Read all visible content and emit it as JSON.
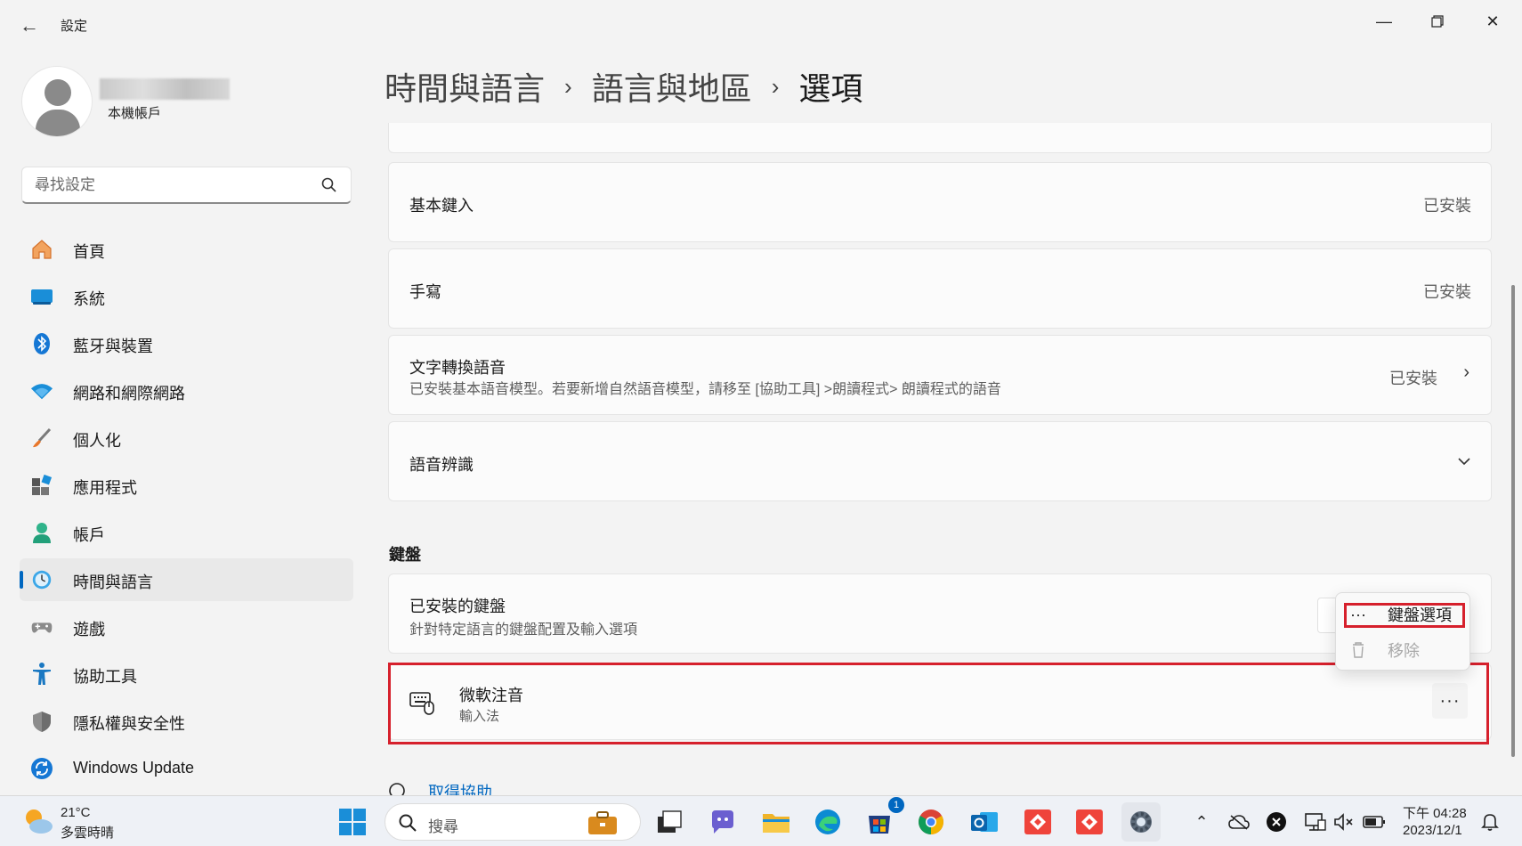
{
  "window": {
    "title": "設定",
    "back_icon": "arrow-left-icon",
    "minimize_icon": "minimize-icon",
    "restore_icon": "restore-icon",
    "close_icon": "close-icon"
  },
  "profile": {
    "account_type": "本機帳戶"
  },
  "search": {
    "placeholder": "尋找設定"
  },
  "sidebar": {
    "items": [
      {
        "label": "首頁",
        "icon": "home-icon"
      },
      {
        "label": "系統",
        "icon": "system-display-icon"
      },
      {
        "label": "藍牙與裝置",
        "icon": "bluetooth-icon"
      },
      {
        "label": "網路和網際網路",
        "icon": "wifi-icon"
      },
      {
        "label": "個人化",
        "icon": "paintbrush-icon"
      },
      {
        "label": "應用程式",
        "icon": "apps-icon"
      },
      {
        "label": "帳戶",
        "icon": "account-icon"
      },
      {
        "label": "時間與語言",
        "icon": "time-language-icon",
        "active": true
      },
      {
        "label": "遊戲",
        "icon": "gamepad-icon"
      },
      {
        "label": "協助工具",
        "icon": "accessibility-icon"
      },
      {
        "label": "隱私權與安全性",
        "icon": "shield-icon"
      },
      {
        "label": "Windows Update",
        "icon": "windows-update-icon"
      }
    ]
  },
  "breadcrumb": {
    "level1": "時間與語言",
    "level2": "語言與地區",
    "current": "選項",
    "separator": "›"
  },
  "features": [
    {
      "title": "基本鍵入",
      "status": "已安裝"
    },
    {
      "title": "手寫",
      "status": "已安裝"
    },
    {
      "title": "文字轉換語音",
      "subtitle": "已安裝基本語音模型。若要新增自然語音模型，請移至 [協助工具] >朗讀程式> 朗讀程式的語音",
      "status": "已安裝"
    },
    {
      "title": "語音辨識"
    }
  ],
  "keyboard_section": {
    "heading": "鍵盤",
    "installed_title": "已安裝的鍵盤",
    "installed_subtitle": "針對特定語言的鍵盤配置及輸入選項",
    "keyboard_item": {
      "name": "微軟注音",
      "type": "輸入法",
      "icon": "keyboard-icon"
    },
    "more_glyph": "···"
  },
  "flyout_menu": {
    "items": [
      {
        "label": "鍵盤選項",
        "icon": "more-icon",
        "enabled": true
      },
      {
        "label": "移除",
        "icon": "trash-icon",
        "enabled": false
      }
    ]
  },
  "help": {
    "label": "取得協助"
  },
  "taskbar": {
    "weather_temp": "21°C",
    "weather_desc": "多雲時晴",
    "search_placeholder": "搜尋",
    "store_badge": "1",
    "clock_time": "下午 04:28",
    "clock_date": "2023/12/1"
  },
  "colors": {
    "accent": "#0067c0",
    "highlight": "#d6202c"
  }
}
